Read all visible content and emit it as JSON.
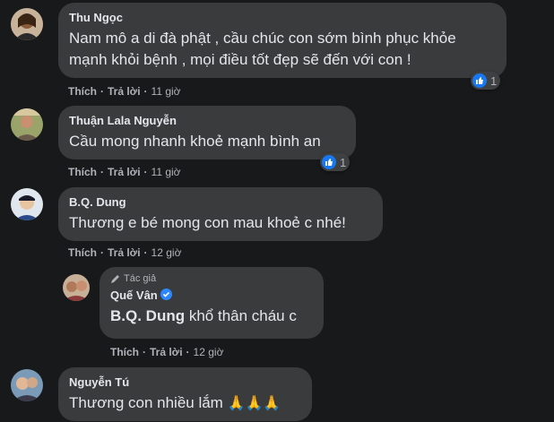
{
  "actions": {
    "like": "Thích",
    "reply": "Trả lời"
  },
  "comments": [
    {
      "author": "Thu Ngọc",
      "lines": [
        "Nam mô a di đà phật , cầu chúc con sớm bình phục khỏe",
        "mạnh khỏi bệnh , mọi điều tốt đẹp sẽ đến với con !"
      ],
      "time": "11 giờ",
      "reactions": "1"
    },
    {
      "author": "Thuận Lala Nguyễn",
      "text": "Cầu mong nhanh khoẻ mạnh bình an",
      "time": "11 giờ",
      "reactions": "1"
    },
    {
      "author": "B.Q. Dung",
      "text": "Thương e bé mong con mau khoẻ c nhé!",
      "time": "12 giờ"
    },
    {
      "author": "Nguyễn Tú",
      "text": "Thương con nhiều lắm",
      "emojis": "🙏🙏🙏"
    }
  ],
  "reply": {
    "author_tag": "Tác giả",
    "author": "Quế Vân",
    "mention": "B.Q. Dung",
    "text": " khổ thân cháu c",
    "time": "12 giờ"
  },
  "colors": {
    "background": "#18191a",
    "bubble": "#3a3b3c",
    "like": "#1877f2",
    "verified": "#2d88ff"
  }
}
